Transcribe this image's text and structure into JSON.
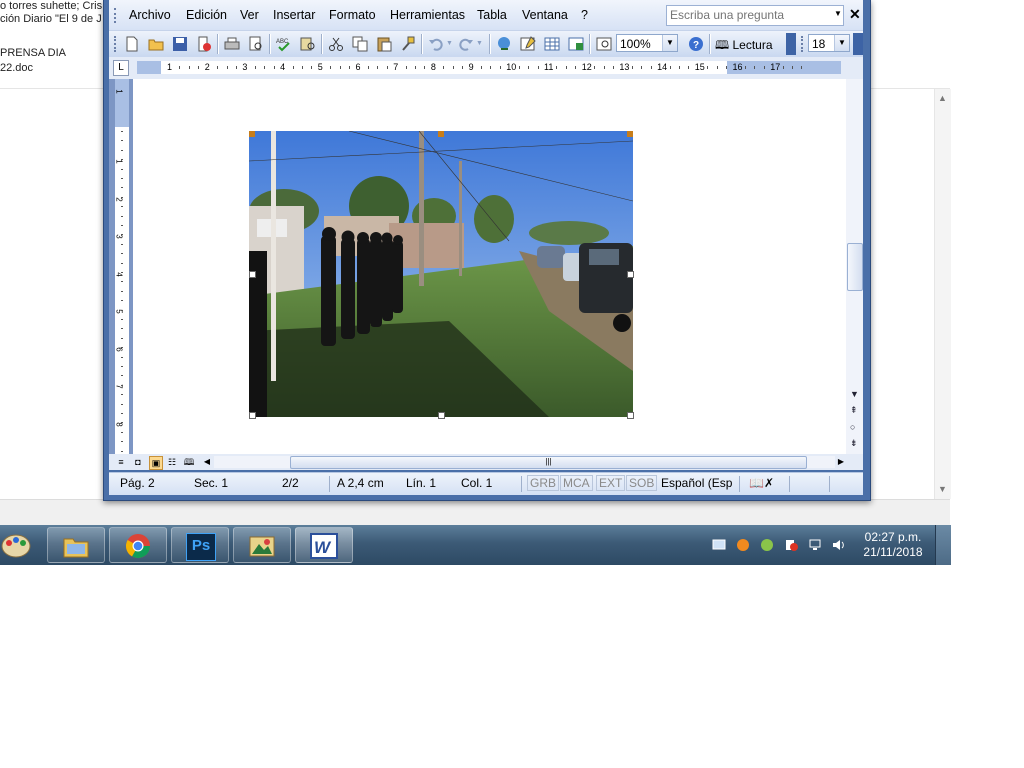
{
  "background_window": {
    "lines": [
      "o torres suhette; Cris",
      "ción Diario \"El 9 de J",
      "PRENSA DIA",
      "22.doc"
    ]
  },
  "word": {
    "menu": [
      "Archivo",
      "Edición",
      "Ver",
      "Insertar",
      "Formato",
      "Herramientas",
      "Tabla",
      "Ventana",
      "?"
    ],
    "ask_placeholder": "Escriba una pregunta",
    "toolbar": {
      "zoom": "100%",
      "reading_label": "Lectura",
      "font_size": "18"
    },
    "ruler": {
      "corner": "L",
      "numbers": [
        "1",
        "2",
        "3",
        "4",
        "5",
        "6",
        "7",
        "8",
        "9",
        "10",
        "11",
        "12",
        "13",
        "14",
        "15",
        "16",
        "17"
      ],
      "vertical_numbers": [
        "1",
        "1",
        "2",
        "3",
        "4",
        "5",
        "6",
        "7",
        "8"
      ]
    },
    "statusbar": {
      "page": "Pág. 2",
      "section": "Sec. 1",
      "page_of": "2/2",
      "at": "A  2,4 cm",
      "line": "Lín. 1",
      "col": "Col. 1",
      "rec": "GRB",
      "trk": "MCA",
      "ext": "EXT",
      "ovr": "SOB",
      "language": "Español (Esp"
    }
  },
  "taskbar": {
    "apps": [
      "paint",
      "file-explorer",
      "chrome",
      "photoshop",
      "photo-viewer",
      "word"
    ],
    "photoshop_label": "Ps",
    "time": "02:27 p.m.",
    "date": "21/11/2018"
  },
  "colors": {
    "word_frame": "#4a6fa8",
    "menubar_bg": "#dce6f6",
    "taskbar": "#3c5a76",
    "selection_handle": "#c77d1a"
  }
}
